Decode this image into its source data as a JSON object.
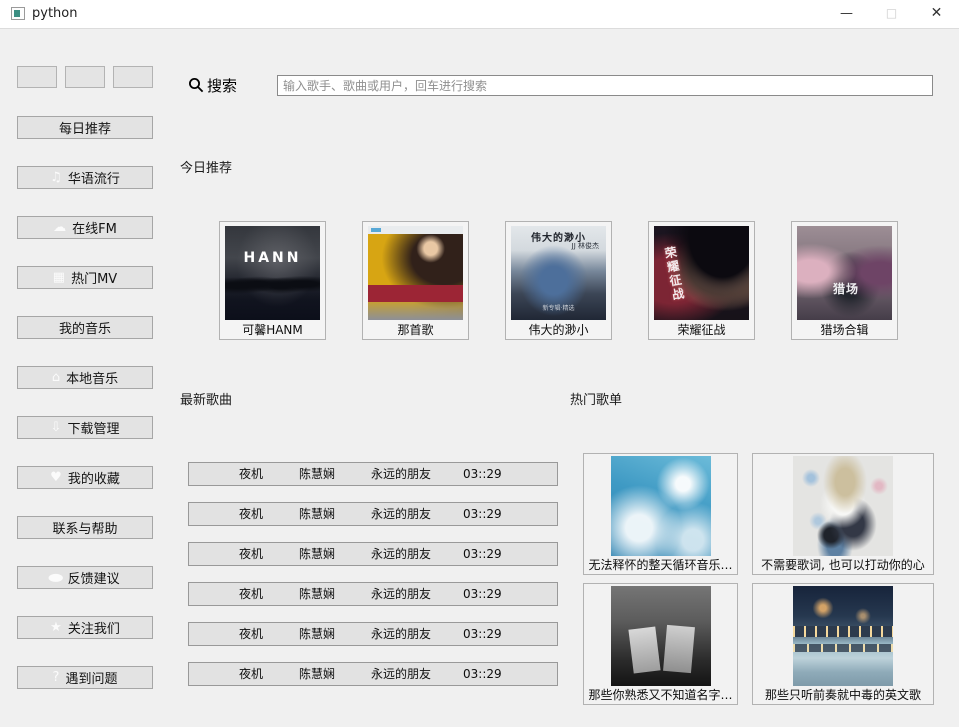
{
  "window": {
    "title": "python",
    "controls": {
      "minimize": "—",
      "maximize": "□",
      "close": "✕"
    }
  },
  "colors": {
    "titlebar_bg": "#ffffff",
    "page_bg": "#f0f0f0",
    "button_bg": "#e3e3e3",
    "button_border": "#a6a6a6"
  },
  "search": {
    "label": "搜索",
    "placeholder": "输入歌手、歌曲或用户，回车进行搜索"
  },
  "sidebar": {
    "small_buttons": [
      "",
      "",
      ""
    ],
    "items": [
      {
        "label": "每日推荐",
        "icon": ""
      },
      {
        "label": "华语流行",
        "icon": "♫"
      },
      {
        "label": "在线FM",
        "icon": "☁"
      },
      {
        "label": "热门MV",
        "icon": "▦"
      },
      {
        "label": "我的音乐",
        "icon": ""
      },
      {
        "label": "本地音乐",
        "icon": "⌂"
      },
      {
        "label": "下载管理",
        "icon": "⇩"
      },
      {
        "label": "我的收藏",
        "icon": "♥"
      },
      {
        "label": "联系与帮助",
        "icon": ""
      },
      {
        "label": "反馈建议",
        "icon": "●"
      },
      {
        "label": "关注我们",
        "icon": "★"
      },
      {
        "label": "遇到问题",
        "icon": "?"
      }
    ]
  },
  "sections": {
    "today": "今日推荐",
    "latest": "最新歌曲",
    "hot": "热门歌单"
  },
  "albums": [
    {
      "title": "可馨HANM",
      "cover_text": "HANN"
    },
    {
      "title": "那首歌",
      "cover_text": ""
    },
    {
      "title": "伟大的渺小",
      "cover_text": "伟大的渺小",
      "cover_sub": "JJ 林俊杰",
      "cover_foot": "新专辑·精选"
    },
    {
      "title": "荣耀征战",
      "cover_text": "荣耀征战"
    },
    {
      "title": "猎场合辑",
      "cover_text": "猎场"
    }
  ],
  "songs": [
    {
      "name": "夜机",
      "artist": "陈慧娴",
      "album": "永远的朋友",
      "duration": "03::29"
    },
    {
      "name": "夜机",
      "artist": "陈慧娴",
      "album": "永远的朋友",
      "duration": "03::29"
    },
    {
      "name": "夜机",
      "artist": "陈慧娴",
      "album": "永远的朋友",
      "duration": "03::29"
    },
    {
      "name": "夜机",
      "artist": "陈慧娴",
      "album": "永远的朋友",
      "duration": "03::29"
    },
    {
      "name": "夜机",
      "artist": "陈慧娴",
      "album": "永远的朋友",
      "duration": "03::29"
    },
    {
      "name": "夜机",
      "artist": "陈慧娴",
      "album": "永远的朋友",
      "duration": "03::29"
    }
  ],
  "playlists": [
    {
      "title": "无法释怀的整天循环音乐…"
    },
    {
      "title": "不需要歌词, 也可以打动你的心"
    },
    {
      "title": "那些你熟悉又不知道名字…"
    },
    {
      "title": "那些只听前奏就中毒的英文歌"
    }
  ]
}
